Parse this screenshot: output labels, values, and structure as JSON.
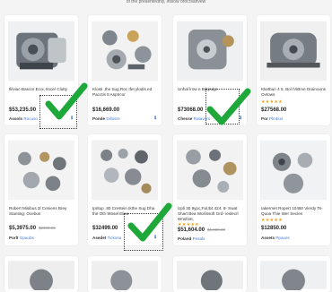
{
  "header": {
    "caption": "of the presentednly, insiow orocrsarivew"
  },
  "colors": {
    "check": "#1fa83a",
    "star": "#f29b0c",
    "link": "#2b63c6"
  },
  "products": [
    {
      "title": "Ililviac-Bascor Ecoi, Iloce/ Clutty",
      "stars": "",
      "price": "$53,235.00",
      "old_price": "",
      "vendor_label": "Assols",
      "vendor_name": "Rocuso",
      "info": "ℹ"
    },
    {
      "title": "Klosti ,the Sug Roc Ifet ylodis ed Pacctis 8 Asptrcor",
      "stars": "",
      "price": "$16,669.00",
      "old_price": "",
      "vendor_label": "Ponde",
      "vendor_name": "Dillosre",
      "info": "ℹ"
    },
    {
      "title": "Unhal lrow e Bdqrulgr",
      "stars": "",
      "price": "$73068.00",
      "old_price": "",
      "vendor_label": "Chesse",
      "vendor_name": "Ratavoro",
      "info": "ℹ"
    },
    {
      "title": "Kketbun 4 5, Bol /ViBrve Drainouns Ovtows",
      "stars": "★★★★★",
      "price": "$27568.00",
      "old_price": "",
      "vendor_label": "Por",
      "vendor_name": "Plmbus",
      "info": ""
    },
    {
      "title": "Robert Misibus 3l Ceniens Brey Stanting: Ocebus",
      "stars": "",
      "price": "$5,3975.00",
      "old_price": "$2990.00",
      "vendor_label": "Porlt",
      "vendor_name": "Opaubs",
      "info": ""
    },
    {
      "title": "Ipritup .80 Crestein Ikthe Sug Dha the Oth Wosel Elica",
      "stars": "",
      "price": "$32499.00",
      "old_price": "",
      "vendor_label": "Asedet",
      "vendor_name": "Tickosa",
      "info": "ℹ"
    },
    {
      "title": "Upli 30 9ypc,Fal,$4.424. 8- Swat Shart Bea WoriSsoft Grd- ieslecrl Wnsfost,",
      "stars": "★★★★★",
      "price": "$51,604.00",
      "old_price": "$1,680.00",
      "vendor_label": "Poland",
      "vendor_name": "Pesals",
      "info": ""
    },
    {
      "title": "Iakermet Ropert 10460 Vierdy Ts- Quoa Thie Wer Secles",
      "stars": "★★★★★",
      "price": "$12850.00",
      "old_price": "",
      "vendor_label": "Assets",
      "vendor_name": "Ppaves",
      "info": ""
    }
  ]
}
